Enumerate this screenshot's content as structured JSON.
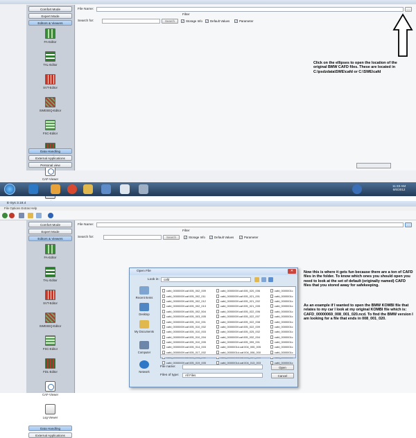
{
  "sidebar": {
    "buttons_top": [
      "Comfort Mode",
      "Expert Mode",
      "Editors & Viewers"
    ],
    "tools": [
      "FA-Editor",
      "TAL-Editor",
      "SVT-Editor",
      "SWESEQ-Editor",
      "FSC-Editor",
      "FDL-Editor",
      "CAF-Viewer",
      "Log-Viewer"
    ],
    "buttons_bottom": [
      "Data Handling",
      "External Applications",
      "Personal view"
    ]
  },
  "form": {
    "file_name_label": "File Name:",
    "ellipsis": "...",
    "filter_label": "Filter",
    "search_label": "Search for:",
    "search_button": "Search",
    "checks": [
      "Storage Info",
      "Default Values",
      "Parameter"
    ]
  },
  "annotation1": "Click on the ellipses to open the location of the original BMW CAFD files.  These are located in C:\\psdzdata\\SWE\\cafd or C:\\SWE\\cafd",
  "clock": {
    "time": "11:33 AM",
    "date": "6/6/2012"
  },
  "app": {
    "title": "E-Sys 3.18.4",
    "menu": "File  Options  Extras  Help"
  },
  "dialog": {
    "title": "Open File",
    "look_in_label": "Look in:",
    "look_in_value": "cafd",
    "places": [
      "Recent Items",
      "Desktop",
      "My Documents",
      "Computer",
      "Network"
    ],
    "col1": [
      "cafd_0000000f.caf.005_002_009",
      "cafd_0000000f.caf.005_002_011",
      "cafd_0000000f.caf.005_002_012",
      "cafd_0000000f.caf.005_002_013",
      "cafd_0000000f.caf.005_002_504",
      "cafd_0000000f.caf.005_003_005",
      "cafd_0000000f.caf.005_010_001",
      "cafd_0000000f.caf.005_010_002",
      "cafd_0000000f.caf.005_010_003",
      "cafd_0000000f.caf.005_010_004",
      "cafd_0000000f.caf.005_010_005",
      "cafd_0000000f.caf.005_014_003",
      "cafd_0000000f.caf.005_017_002",
      "cafd_0000000f.caf.005_018_002",
      "cafd_0000000f.caf.005_019_005"
    ],
    "col2": [
      "cafd_0000000f.caf.005_020_006",
      "cafd_0000000f.caf.005_021_001",
      "cafd_0000000f.caf.005_021_002",
      "cafd_0000000f.caf.005_021_005",
      "cafd_0000000f.caf.005_022_006",
      "cafd_0000000f.caf.005_022_007",
      "cafd_0000000f.caf.005_022_008",
      "cafd_0000000f.caf.005_022_009",
      "cafd_0000000f.caf.005_025_002",
      "cafd_0000000f.caf.005_032_004",
      "cafd_0000000f.caf.005_099_001",
      "cafd_0000001d.caf.004_005_005",
      "cafd_0000001d.caf.004_006_000",
      "cafd_0000001d.caf.004_007_000",
      "cafd_0000001d.caf.004_013_003"
    ],
    "col3": [
      "cafd_0000001c",
      "cafd_0000001c",
      "cafd_0000001c",
      "cafd_0000001c",
      "cafd_0000001c",
      "cafd_0000001c",
      "cafd_0000001c",
      "cafd_0000001c",
      "cafd_0000001c",
      "cafd_0000001c",
      "cafd_0000001c",
      "cafd_0000001c",
      "cafd_0000001c",
      "cafd_0000001c",
      "cafd_0000001c"
    ],
    "file_name_label": "File name:",
    "file_type_label": "Files of type:",
    "file_type_value": "All Files",
    "open_button": "Open",
    "cancel_button": "Cancel"
  },
  "annotation2a": "Now this is where it gets fun because there are a ton of CAFD files in the folder.  To know which ones you should open you need to look at the set of default (originally named) CAFD files that you stored away for safekeeping.",
  "annotation2b": "As an example if I wanted to open the BMW KOMBI file that relates to my car I look at my original KOMBI file which is:  CAFD_00000069_008_001_020.ncd.  To find the BMW version I am looking for a file that ends in 008_001_020."
}
